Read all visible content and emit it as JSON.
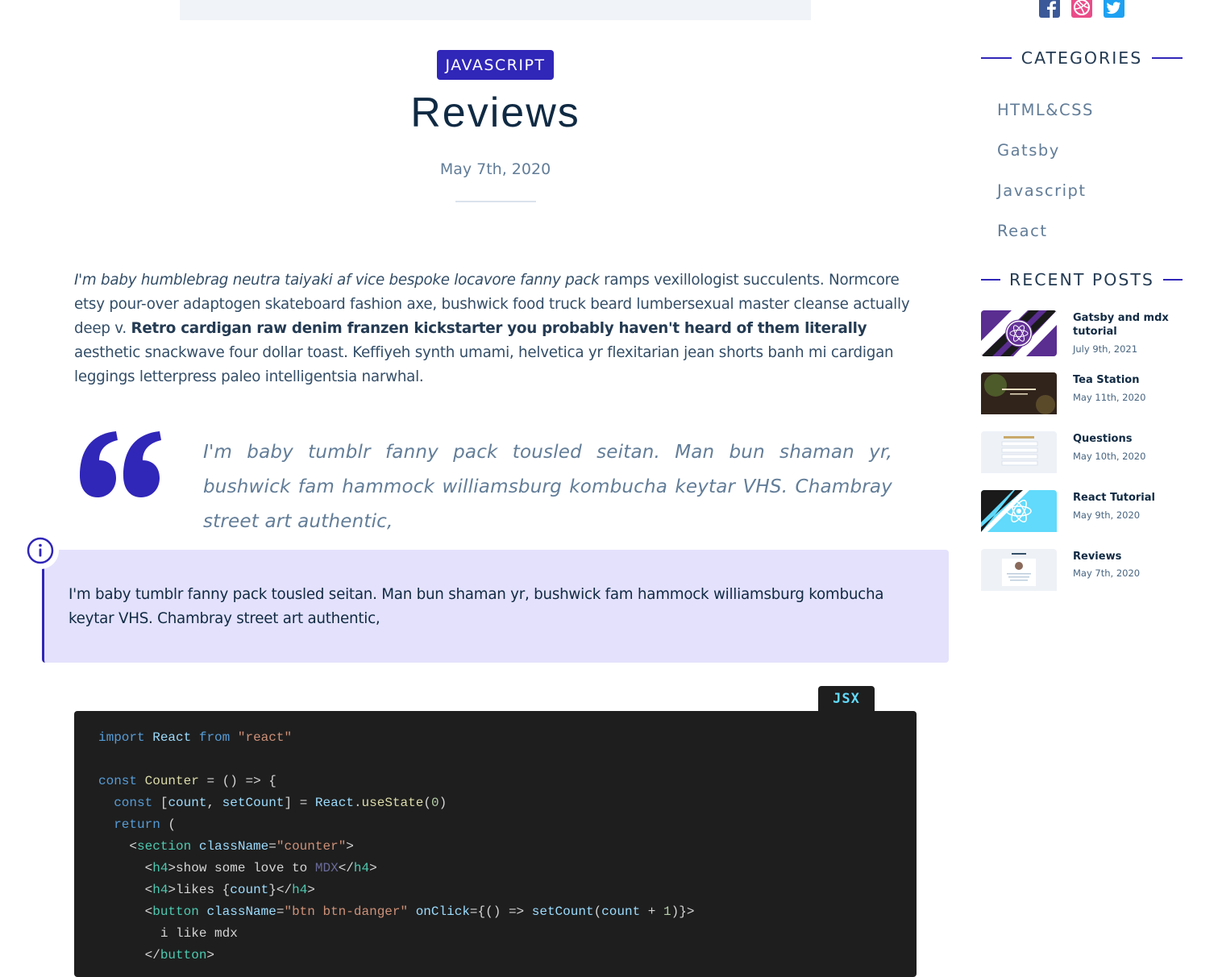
{
  "article": {
    "category": "JAVASCRIPT",
    "title": "Reviews",
    "date": "May 7th, 2020",
    "intro_italic": "I'm baby humblebrag neutra taiyaki af vice bespoke locavore fanny pack",
    "intro_rest_1": " ramps vexillologist succulents. Normcore etsy pour-over adaptogen skateboard fashion axe, bushwick food truck beard lumbersexual master cleanse actually deep v. ",
    "intro_bold": "Retro cardigan raw denim franzen kickstarter you probably haven't heard of them literally",
    "intro_rest_2": " aesthetic snackwave four dollar toast. Keffiyeh synth umami, helvetica yr flexitarian jean shorts banh mi cardigan leggings letterpress paleo intelligentsia narwhal.",
    "blockquote": "I'm baby tumblr fanny pack tousled seitan. Man bun shaman yr, bushwick fam hammock williamsburg kombucha keytar VHS. Chambray street art authentic,",
    "callout": "I'm baby tumblr fanny pack tousled seitan. Man bun shaman yr, bushwick fam hammock williamsburg kombucha keytar VHS. Chambray street art authentic,"
  },
  "code": {
    "language": "JSX",
    "lines": [
      "import React from \"react\"",
      "",
      "const Counter = () => {",
      "  const [count, setCount] = React.useState(0)",
      "  return (",
      "    <section className=\"counter\">",
      "      <h4>show some love to MDX</h4>",
      "      <h4>likes {count}</h4>",
      "      <button className=\"btn btn-danger\" onClick={() => setCount(count + 1)}>",
      "        i like mdx",
      "      </button>"
    ]
  },
  "social": {
    "icons": [
      "facebook-icon",
      "dribbble-icon",
      "twitter-icon"
    ],
    "colors": {
      "facebook": "#3b5998",
      "dribbble": "#ea4c89",
      "twitter": "#1da1f2"
    }
  },
  "sidebar": {
    "categories_heading": "CATEGORIES",
    "categories": [
      "HTML&CSS",
      "Gatsby",
      "Javascript",
      "React"
    ],
    "recent_heading": "RECENT POSTS",
    "recent_posts": [
      {
        "title": "Gatsby and mdx tutorial",
        "date": "July 9th, 2021"
      },
      {
        "title": "Tea Station",
        "date": "May 11th, 2020"
      },
      {
        "title": "Questions",
        "date": "May 10th, 2020"
      },
      {
        "title": "React Tutorial",
        "date": "May 9th, 2020"
      },
      {
        "title": "Reviews",
        "date": "May 7th, 2020"
      }
    ]
  },
  "colors": {
    "accent": "#3026b8",
    "callout_bg": "#e3e1fc",
    "code_bg": "#1e1e1e",
    "heading": "#102a43",
    "muted": "#627d98"
  }
}
